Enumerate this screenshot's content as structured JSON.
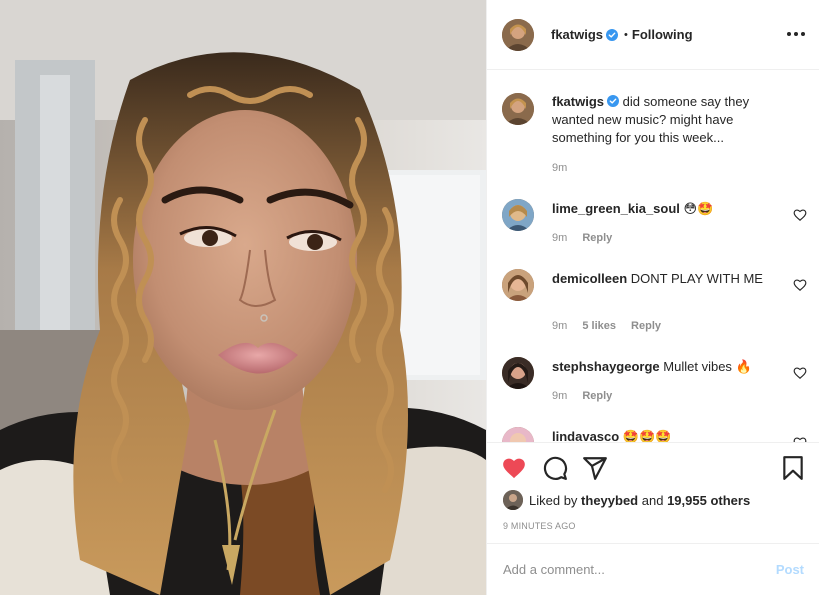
{
  "post": {
    "username": "fkatwigs",
    "follow_status": "Following",
    "separator": "•",
    "more_icon": "more-horizontal-icon"
  },
  "caption": {
    "username": "fkatwigs",
    "text": "did someone say they wanted new music? might have something for you this week...",
    "time": "9m"
  },
  "comments": [
    {
      "username": "lime_green_kia_soul",
      "text": "😳🤩",
      "time": "9m",
      "likes": "",
      "reply": "Reply"
    },
    {
      "username": "demicolleen",
      "text": "DONT PLAY WITH ME",
      "time": "9m",
      "likes": "5 likes",
      "reply": "Reply"
    },
    {
      "username": "stephshaygeorge",
      "text": "Mullet vibes 🔥",
      "time": "9m",
      "likes": "",
      "reply": "Reply"
    },
    {
      "username": "lindavasco",
      "text": "🤩🤩🤩",
      "time": "",
      "likes": "",
      "reply": ""
    }
  ],
  "actions": {
    "like_icon": "heart-filled-icon",
    "comment_icon": "comment-icon",
    "share_icon": "paper-plane-icon",
    "save_icon": "bookmark-icon",
    "like_color": "#ed4956"
  },
  "likes": {
    "prefix": "Liked by",
    "user": "theyybed",
    "and": "and",
    "count": "19,955 others"
  },
  "timestamp": "9 MINUTES AGO",
  "composer": {
    "placeholder": "Add a comment...",
    "post_label": "Post"
  },
  "colors": {
    "verified": "#3897f0",
    "meta": "#8e8e8e",
    "post_disabled": "#b3dbff"
  }
}
